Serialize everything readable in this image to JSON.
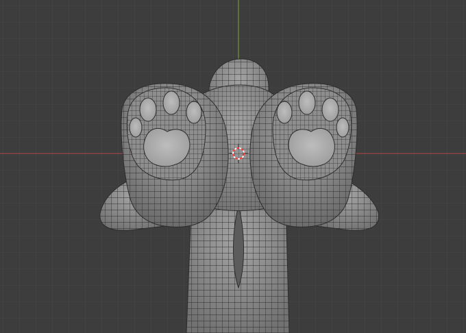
{
  "viewport": {
    "background_color": "#3d3d3d",
    "grid_minor_color": "#474747",
    "grid_major_color": "#4c4c4c",
    "x_axis_color": "#b0484a",
    "y_axis_color": "#7ea537",
    "mesh_fill_color": "#9a9a9a",
    "mesh_shade_color": "#6f6f6f",
    "wire_color": "#2c2c2c",
    "pad_fill_color": "#b4b4b4",
    "pivot_icon": "3d-cursor-icon",
    "pivot_colors": [
      "#ff3b3b",
      "#ffffff"
    ]
  }
}
